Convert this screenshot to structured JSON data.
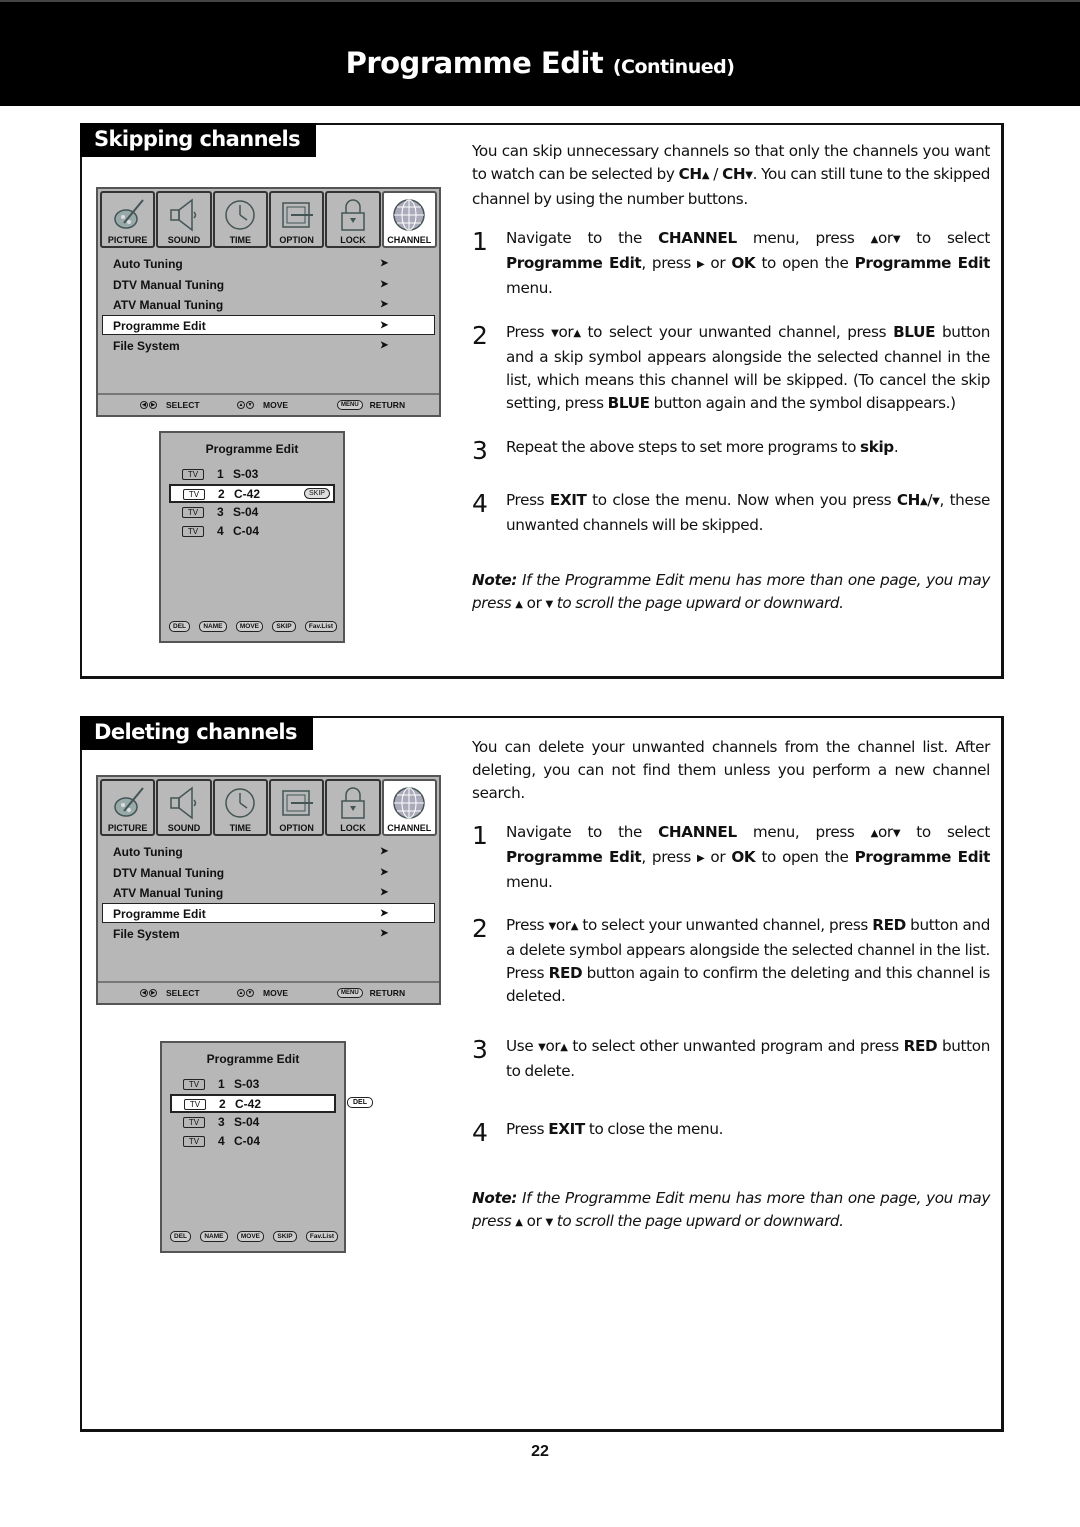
{
  "header": {
    "title": "Programme Edit",
    "subtitle": "(Continued)"
  },
  "tv_menu": {
    "tabs": [
      {
        "label": "PICTURE",
        "icon": "picture-icon",
        "active": false
      },
      {
        "label": "SOUND",
        "icon": "sound-icon",
        "active": false
      },
      {
        "label": "TIME",
        "icon": "clock-icon",
        "active": false
      },
      {
        "label": "OPTION",
        "icon": "option-icon",
        "active": false
      },
      {
        "label": "LOCK",
        "icon": "lock-icon",
        "active": false
      },
      {
        "label": "CHANNEL",
        "icon": "globe-icon",
        "active": true
      }
    ],
    "items": [
      {
        "label": "Auto Tuning",
        "arrow": "➤"
      },
      {
        "label": "DTV Manual Tuning",
        "arrow": "➤"
      },
      {
        "label": "ATV Manual Tuning",
        "arrow": "➤"
      },
      {
        "label": "Programme Edit",
        "arrow": "➤",
        "selected": true
      },
      {
        "label": "File System",
        "arrow": "➤"
      }
    ],
    "footer": {
      "select_label": "SELECT",
      "move_label": "MOVE",
      "menu_key": "MENU",
      "return_label": "RETURN"
    }
  },
  "programme_edit": {
    "title": "Programme Edit",
    "rows": [
      {
        "type": "TV",
        "num": "1",
        "channel": "S-03"
      },
      {
        "type": "TV",
        "num": "2",
        "channel": "C-42",
        "selected": true
      },
      {
        "type": "TV",
        "num": "3",
        "channel": "S-04"
      },
      {
        "type": "TV",
        "num": "4",
        "channel": "C-04"
      }
    ],
    "buttons": [
      "DEL",
      "NAME",
      "MOVE",
      "SKIP",
      "Fav.List"
    ],
    "skip_badge": "SKIP",
    "del_badge": "DEL"
  },
  "skipping": {
    "title": "Skipping channels",
    "intro_1": "You can skip unnecessary channels so that only the channels you want to watch can be selected by ",
    "ch": "CH",
    "intro_sep": " / ",
    "intro_2": ". You can still tune to the skipped channel by using the number buttons.",
    "steps": [
      {
        "n": "1"
      },
      {
        "n": "2"
      },
      {
        "n": "3"
      },
      {
        "n": "4"
      }
    ],
    "s1": {
      "a": "Navigate to the ",
      "b1": "CHANNEL",
      "c": " menu,  press ",
      "d": "or",
      "e": " to select ",
      "b2": "Programme Edit",
      "f": ", press ",
      "g": " or ",
      "b3": "OK",
      "h": " to open the ",
      "b4": "Programme Edit",
      "i": " menu."
    },
    "s2": {
      "a": "Press ",
      "d": "or",
      "e": " to select your unwanted channel, press ",
      "b1": "BLUE",
      "f": " button and a skip symbol appears alongside the selected channel in the list, which means this channel will be skipped. (To cancel the skip setting, press ",
      "b2": "BLUE",
      "g": " button again and the symbol disappears.)"
    },
    "s3": {
      "a": "Repeat the above steps to set more programs to ",
      "b1": "skip",
      "c": "."
    },
    "s4": {
      "a": "Press ",
      "b1": "EXIT",
      "c": " to close the menu. Now when you press ",
      "b2": "CH",
      "d": "/",
      "e": ", these unwanted channels will be skipped."
    },
    "note": {
      "label": "Note:",
      "a": " If the Programme Edit menu has more than one page, you may press ",
      "or": "or",
      "b": " to scroll the page upward or downward."
    }
  },
  "deleting": {
    "title": "Deleting channels",
    "intro": "You can delete your unwanted channels from the channel list. After deleting, you can not find them unless you perform a new channel search.",
    "steps": [
      {
        "n": "1"
      },
      {
        "n": "2"
      },
      {
        "n": "3"
      },
      {
        "n": "4"
      }
    ],
    "s1": {
      "a": "Navigate to the ",
      "b1": "CHANNEL",
      "c": " menu,  press ",
      "d": "or",
      "e": " to select ",
      "b2": "Programme Edit",
      "f": ", press ",
      "g": " or ",
      "b3": "OK",
      "h": " to open the ",
      "b4": "Programme Edit",
      "i": " menu."
    },
    "s2": {
      "a": "Press ",
      "d": "or",
      "e": " to select your unwanted channel, press ",
      "b1": "RED",
      "f": " button and a delete symbol appears alongside the selected channel in the list. Press ",
      "b2": "RED",
      "g": " button again to confirm the deleting and this channel is deleted."
    },
    "s3": {
      "a": "Use ",
      "d": "or",
      "e": " to select other unwanted program and press ",
      "b1": "RED",
      "f": " button to delete."
    },
    "s4": {
      "a": "Press ",
      "b1": "EXIT",
      "c": " to close the menu."
    },
    "note": {
      "label": "Note:",
      "a": " If the Programme Edit menu has more than one page, you may press ",
      "or": "or",
      "b": " to scroll the page upward or downward."
    }
  },
  "page_number": "22"
}
